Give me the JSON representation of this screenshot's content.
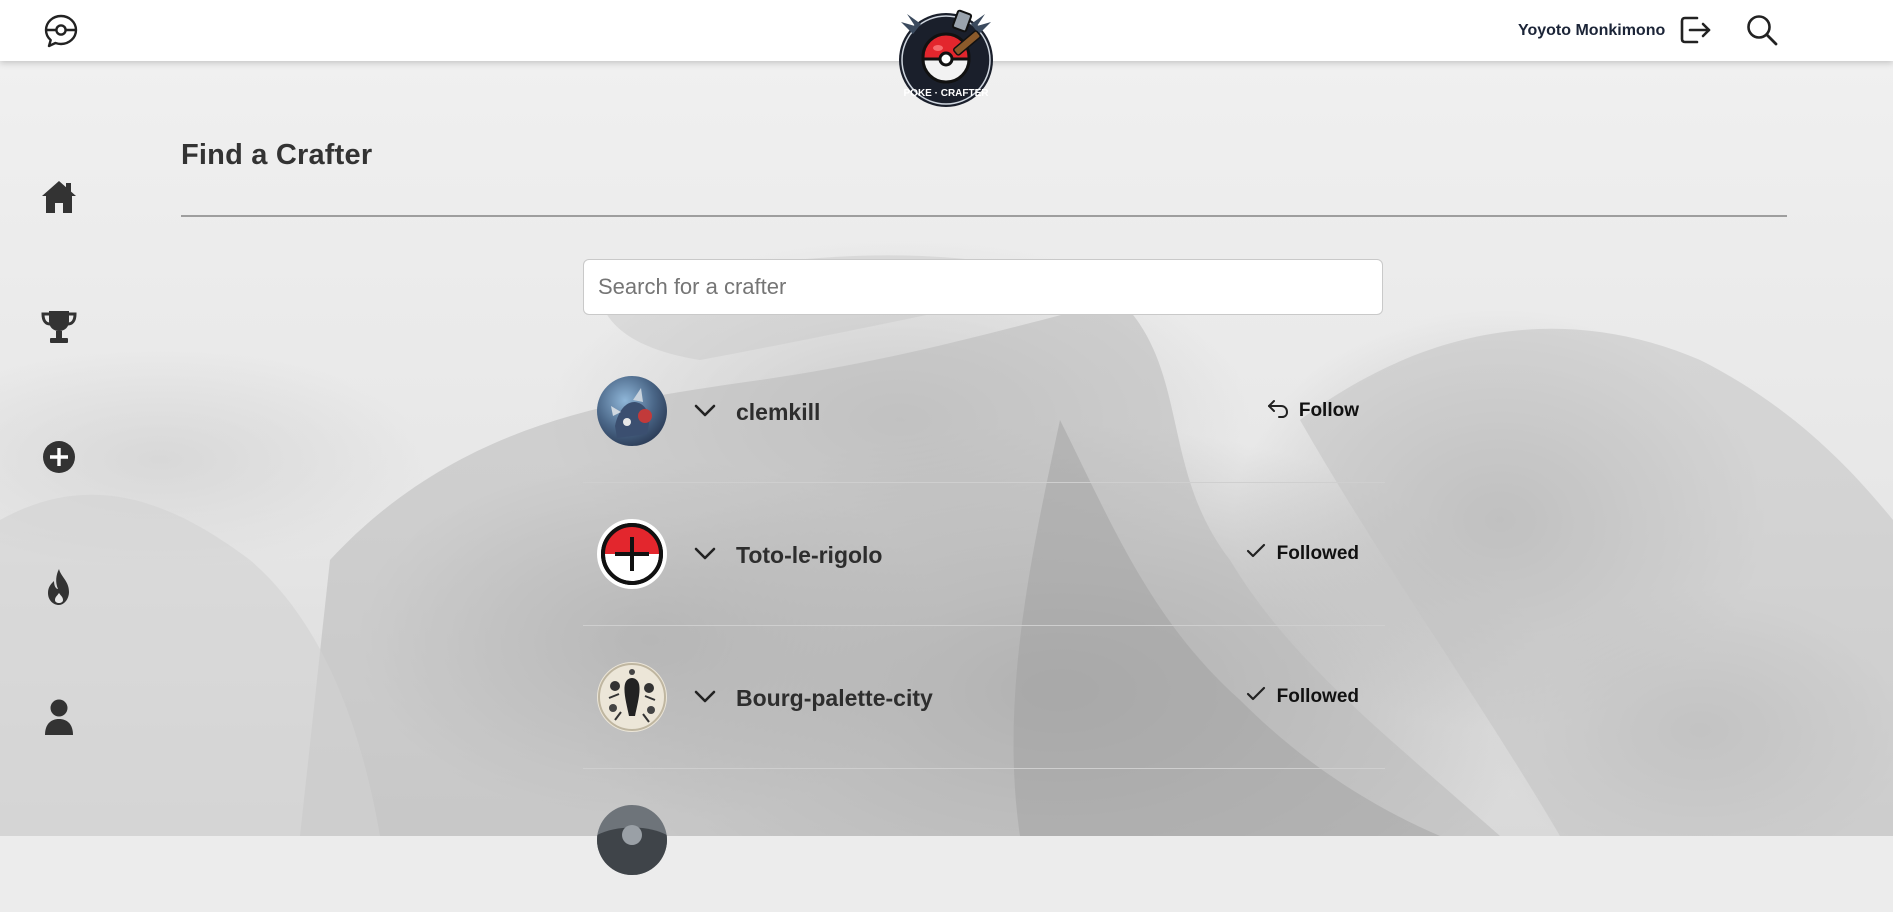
{
  "header": {
    "username": "Yoyoto Monkimono",
    "logo_text": "POKE · CRAFTER",
    "icons": [
      "pokeball-chat-icon",
      "logout-icon",
      "search-icon"
    ]
  },
  "sidebar": {
    "items": [
      {
        "name": "home",
        "icon": "home-icon"
      },
      {
        "name": "trophy",
        "icon": "trophy-icon"
      },
      {
        "name": "create",
        "icon": "plus-circle-icon"
      },
      {
        "name": "trending",
        "icon": "fire-icon"
      },
      {
        "name": "profile",
        "icon": "user-icon"
      }
    ]
  },
  "main": {
    "title": "Find a Crafter",
    "search": {
      "placeholder": "Search for a crafter",
      "value": ""
    },
    "crafters": [
      {
        "name": "clemkill",
        "status": "Follow",
        "status_icon": "follow-arrow-icon",
        "avatar": "artwork-avatar"
      },
      {
        "name": "Toto-le-rigolo",
        "status": "Followed",
        "status_icon": "check-icon",
        "avatar": "pokeball-plus-avatar"
      },
      {
        "name": "Bourg-palette-city",
        "status": "Followed",
        "status_icon": "check-icon",
        "avatar": "monochrome-art-avatar"
      }
    ]
  },
  "colors": {
    "topbar": "#ffffff",
    "title_text": "#333333",
    "pokeball_red": "#e3262d",
    "username_text": "#1b2437"
  }
}
